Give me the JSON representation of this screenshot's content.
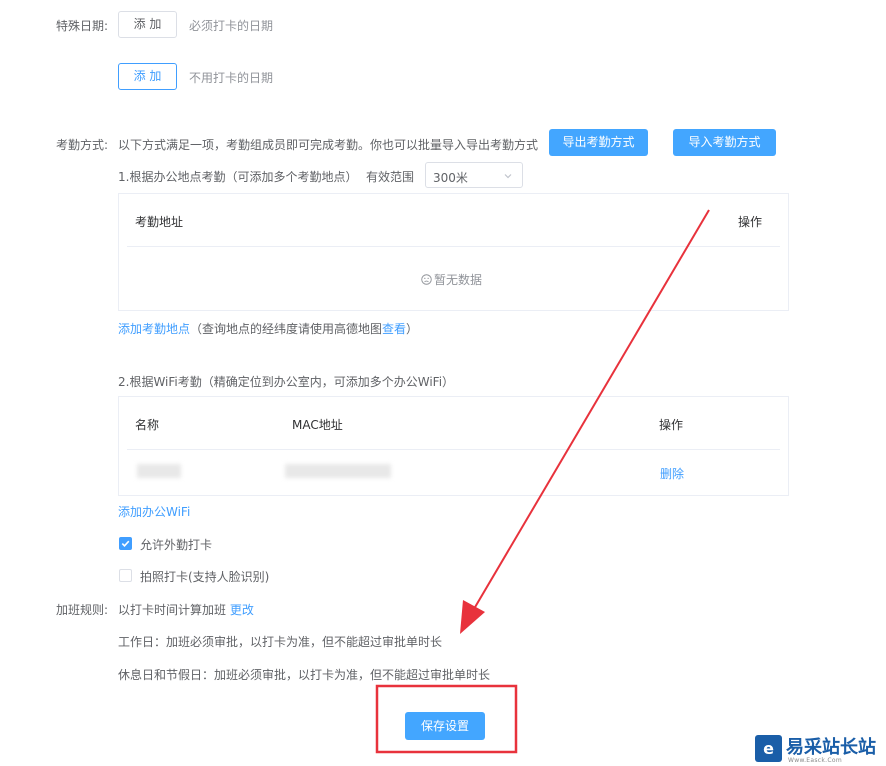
{
  "special_dates": {
    "label": "特殊日期:",
    "add_button_1": "添 加",
    "hint_1": "必须打卡的日期",
    "add_button_2": "添 加",
    "hint_2": "不用打卡的日期"
  },
  "attendance_method": {
    "label": "考勤方式:",
    "description": "以下方式满足一项，考勤组成员即可完成考勤。你也可以批量导入导出考勤方式",
    "export_button": "导出考勤方式",
    "import_button": "导入考勤方式"
  },
  "office_location": {
    "title": "1.根据办公地点考勤（可添加多个考勤地点）",
    "range_label": "有效范围",
    "range_value": "300米",
    "table": {
      "col_address": "考勤地址",
      "col_action": "操作",
      "empty_text": "暂无数据"
    },
    "add_link": "添加考勤地点",
    "hint_prefix": "（查询地点的经纬度请使用高德地图",
    "hint_link": "查看",
    "hint_suffix": "）"
  },
  "wifi": {
    "title": "2.根据WiFi考勤（精确定位到办公室内，可添加多个办公WiFi）",
    "table": {
      "col_name": "名称",
      "col_mac": "MAC地址",
      "col_action": "操作",
      "rows": [
        {
          "delete": "删除"
        }
      ]
    },
    "add_link": "添加办公WiFi"
  },
  "options": {
    "allow_outside": {
      "label": "允许外勤打卡",
      "checked": true
    },
    "photo_punch": {
      "label": "拍照打卡(支持人脸识别)",
      "checked": false
    }
  },
  "overtime": {
    "label": "加班规则:",
    "rule_text": "以打卡时间计算加班",
    "change_link": "更改",
    "workday": "工作日：加班必须审批，以打卡为准，但不能超过审批单时长",
    "holiday": "休息日和节假日：加班必须审批，以打卡为准，但不能超过审批单时长"
  },
  "save_button": "保存设置",
  "watermark": {
    "text": "易采站长站",
    "sub": "Www.Easck.Com"
  },
  "colors": {
    "primary": "#43a6ff",
    "link": "#409eff",
    "annotation_red": "#e8323c"
  }
}
